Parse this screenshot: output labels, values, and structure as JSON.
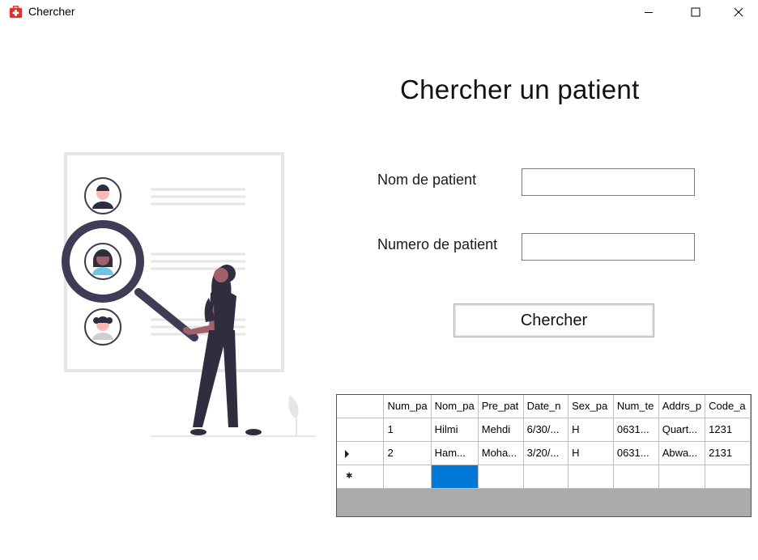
{
  "window": {
    "title": "Chercher",
    "controls": [
      "minimize-icon",
      "maximize-icon",
      "close-icon"
    ]
  },
  "form": {
    "heading": "Chercher un patient",
    "nom_label": "Nom de patient",
    "nom_value": "",
    "numero_label": "Numero de patient",
    "numero_value": "",
    "search_button": "Chercher"
  },
  "grid": {
    "columns": [
      "Num_pa",
      "Nom_pa",
      "Pre_pat",
      "Date_n",
      "Sex_pa",
      "Num_te",
      "Addrs_p",
      "Code_a"
    ],
    "rows": [
      [
        "1",
        "Hilmi",
        "Mehdi",
        "6/30/...",
        "H",
        "0631...",
        "Quart...",
        "1231"
      ],
      [
        "2",
        "Ham...",
        "Moha...",
        "3/20/...",
        "H",
        "0631...",
        "Abwa...",
        "2131"
      ]
    ],
    "current_row_marker": "right-triangle-icon",
    "new_row_marker": "asterisk-icon"
  },
  "colors": {
    "selection": "#0078d7",
    "grid_background": "#ababab",
    "illustration_dark": "#2f2e41",
    "illustration_light": "#e6e6e6",
    "accent_blue": "#6ec6e6"
  }
}
